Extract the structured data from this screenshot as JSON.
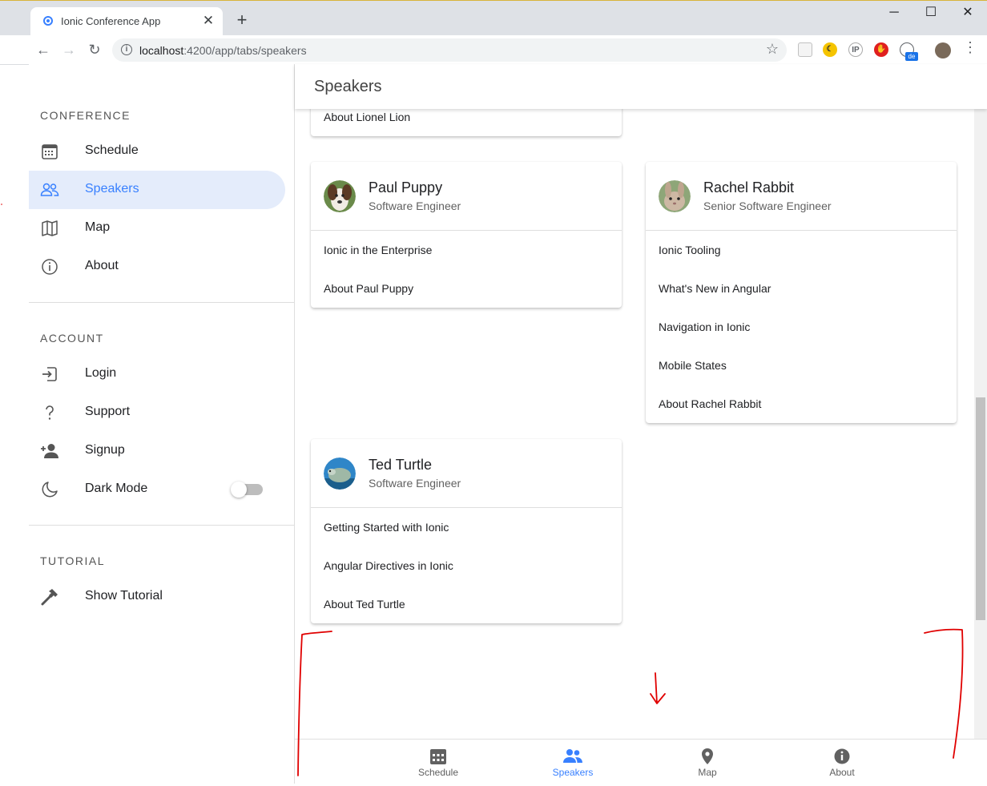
{
  "browser": {
    "tab_title": "Ionic Conference App",
    "tab_close": "✕",
    "new_tab": "+",
    "url_host": "localhost",
    "url_rest": ":4200/app/tabs/speakers",
    "window_controls": {
      "minimize": "─",
      "maximize": "☐",
      "close": "✕"
    },
    "nav": {
      "back": "←",
      "forward": "→",
      "reload": "↻"
    },
    "extensions": {
      "ip": "IP",
      "de_badge": "de"
    }
  },
  "menu": {
    "sections": [
      {
        "header": "CONFERENCE",
        "items": [
          {
            "label": "Schedule",
            "icon": "calendar-icon"
          },
          {
            "label": "Speakers",
            "icon": "people-icon",
            "active": true
          },
          {
            "label": "Map",
            "icon": "map-icon"
          },
          {
            "label": "About",
            "icon": "info-icon"
          }
        ]
      },
      {
        "header": "ACCOUNT",
        "items": [
          {
            "label": "Login",
            "icon": "login-icon"
          },
          {
            "label": "Support",
            "icon": "help-icon"
          },
          {
            "label": "Signup",
            "icon": "person-add-icon"
          },
          {
            "label": "Dark Mode",
            "icon": "moon-icon",
            "toggle": false
          }
        ]
      },
      {
        "header": "TUTORIAL",
        "items": [
          {
            "label": "Show Tutorial",
            "icon": "hammer-icon"
          }
        ]
      }
    ]
  },
  "page": {
    "title": "Speakers"
  },
  "speakers": {
    "lionel": {
      "sessions": [
        "About Lionel Lion"
      ]
    },
    "paul": {
      "name": "Paul Puppy",
      "role": "Software Engineer",
      "sessions": [
        "Ionic in the Enterprise",
        "About Paul Puppy"
      ]
    },
    "rachel": {
      "name": "Rachel Rabbit",
      "role": "Senior Software Engineer",
      "sessions": [
        "Ionic Tooling",
        "What's New in Angular",
        "Navigation in Ionic",
        "Mobile States",
        "About Rachel Rabbit"
      ]
    },
    "ted": {
      "name": "Ted Turtle",
      "role": "Software Engineer",
      "sessions": [
        "Getting Started with Ionic",
        "Angular Directives in Ionic",
        "About Ted Turtle"
      ]
    }
  },
  "tabs": [
    {
      "label": "Schedule",
      "icon": "calendar-icon"
    },
    {
      "label": "Speakers",
      "icon": "people-icon",
      "active": true
    },
    {
      "label": "Map",
      "icon": "location-icon"
    },
    {
      "label": "About",
      "icon": "info-icon"
    }
  ],
  "colors": {
    "accent": "#3880ff",
    "annotation": "#e00000"
  }
}
